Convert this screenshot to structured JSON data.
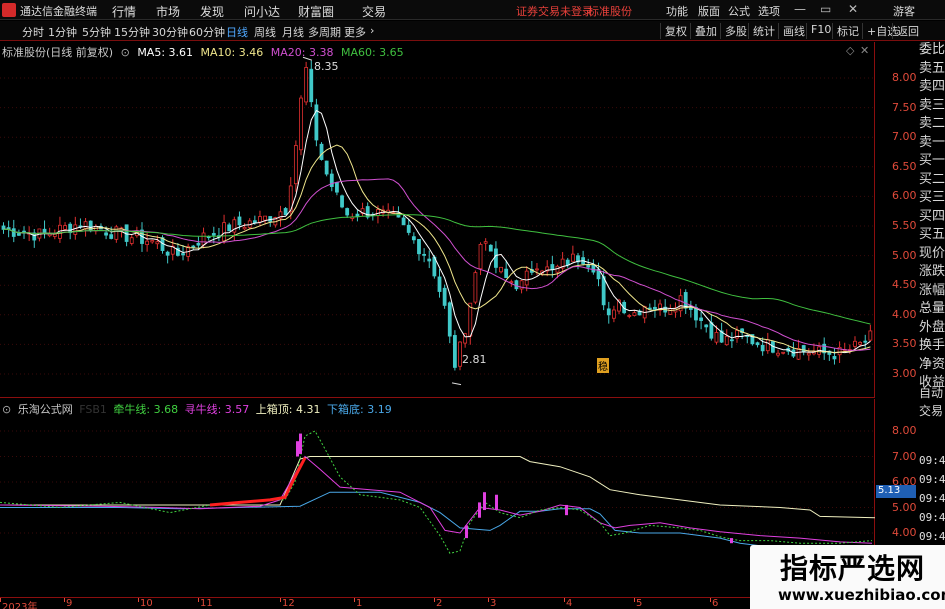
{
  "menubar": {
    "app_title": "通达信金融终端",
    "menus": [
      "行情",
      "市场",
      "发现",
      "问小达",
      "财富圈",
      "交易"
    ],
    "login_notice": "证券交易未登录",
    "stock_name": "标准股份",
    "right_menus": [
      "功能",
      "版面",
      "公式",
      "选项"
    ],
    "guest": "游客"
  },
  "toolbar": {
    "periods": [
      "分时",
      "1分钟",
      "5分钟",
      "15分钟",
      "30分钟",
      "60分钟",
      "日线",
      "周线",
      "月线",
      "多周期",
      "更多"
    ],
    "active_period": "日线",
    "buttons": [
      "复权",
      "叠加",
      "多股",
      "统计",
      "画线",
      "F10",
      "标记",
      "+自选",
      "返回"
    ]
  },
  "main": {
    "title": "标准股份(日线 前复权)",
    "ma5_label": "MA5: 3.61",
    "ma10_label": "MA10: 3.46",
    "ma20_label": "MA20: 3.38",
    "ma60_label": "MA60: 3.65",
    "high_label": "8.35",
    "low_label": "2.81",
    "marker": "稳",
    "price_ticks": [
      "8.00",
      "7.50",
      "7.00",
      "6.50",
      "6.00",
      "5.50",
      "5.00",
      "4.50",
      "4.00",
      "3.50",
      "3.00"
    ],
    "colors": {
      "ma5": "#ffffff",
      "ma10": "#f0e68c",
      "ma20": "#d050d0",
      "ma60": "#40c040",
      "up": "#e03030",
      "down": "#40c8c8"
    }
  },
  "indicator": {
    "title": "乐淘公式网",
    "faded": "FSB1",
    "line1_label": "牵牛线: 3.68",
    "line2_label": "寻牛线: 3.57",
    "line3_label": "上箱顶: 4.31",
    "line4_label": "下箱底: 3.19",
    "ticks": [
      "8.00",
      "7.00",
      "6.00",
      "5.00",
      "4.00"
    ],
    "price_tag": "5.13",
    "colors": {
      "l1": "#40d040",
      "l2": "#e040e0",
      "l3": "#f0f0c0",
      "l4": "#4aa8e8"
    }
  },
  "dates": [
    "2023年",
    "9",
    "10",
    "11",
    "12",
    "1",
    "2",
    "3",
    "4",
    "5",
    "6"
  ],
  "side": {
    "items": [
      "委比",
      "卖五",
      "卖四",
      "卖三",
      "卖二",
      "卖一",
      "买一",
      "买二",
      "买三",
      "买四",
      "买五",
      "现价",
      "涨跌",
      "涨幅",
      "总量",
      "外盘",
      "换手",
      "净资",
      "收益"
    ],
    "items2": [
      "自动",
      "交易"
    ],
    "times": [
      "09:45",
      "09:45",
      "09:46",
      "09:46",
      "09:46",
      "09:46",
      "09:46",
      "09:46"
    ]
  },
  "watermark": {
    "line1": "指标严选网",
    "line2": "www.xuezhibiao.com"
  }
}
